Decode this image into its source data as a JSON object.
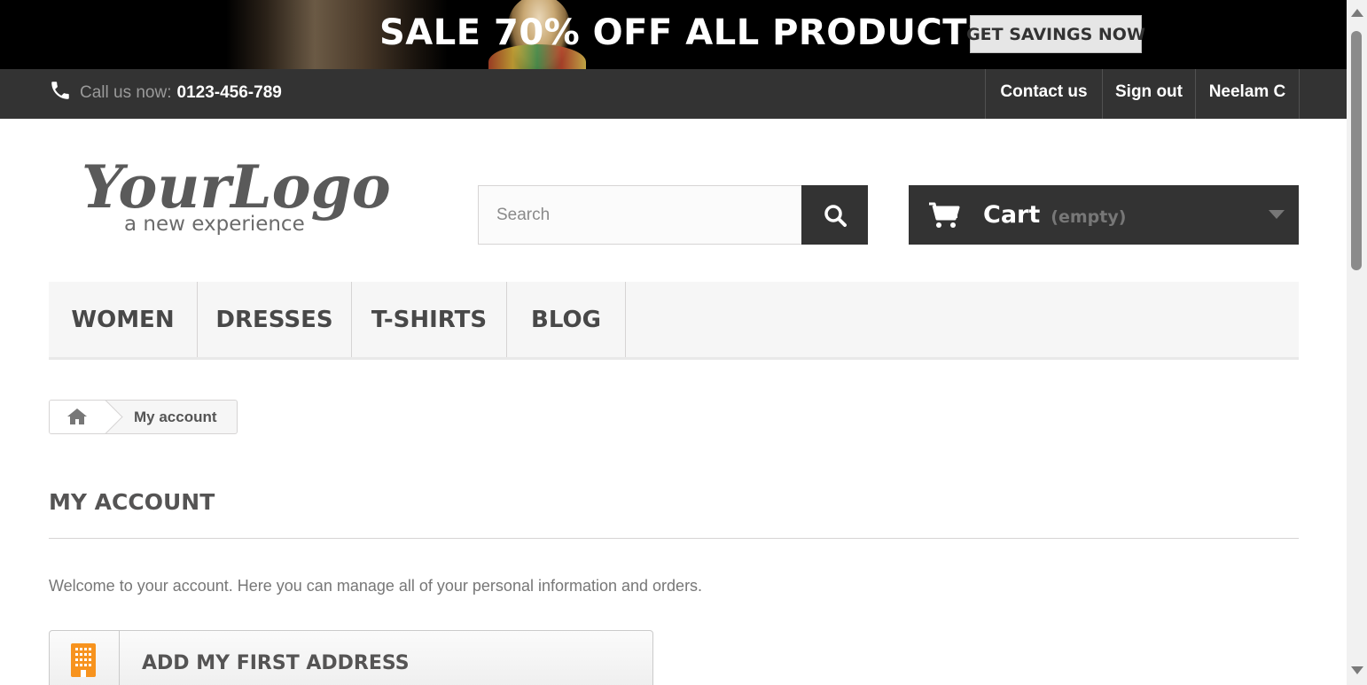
{
  "banner": {
    "headline": "SALE 70% OFF ALL PRODUCTS",
    "cta_label": "GET SAVINGS NOW"
  },
  "top_nav": {
    "call_label": "Call us now:",
    "phone_number": "0123-456-789",
    "links": [
      "Contact us",
      "Sign out",
      "Neelam C"
    ]
  },
  "header": {
    "logo": {
      "main_text": "YourLogo",
      "tagline": "a new experience"
    },
    "search": {
      "placeholder": "Search",
      "value": ""
    },
    "cart": {
      "label": "Cart",
      "status": "(empty)"
    }
  },
  "menu": {
    "items": [
      "WOMEN",
      "DRESSES",
      "T-SHIRTS",
      "BLOG"
    ]
  },
  "breadcrumb": {
    "current": "My account"
  },
  "page": {
    "heading": "MY ACCOUNT",
    "welcome": "Welcome to your account. Here you can manage all of your personal information and orders.",
    "actions": [
      {
        "label": "ADD MY FIRST ADDRESS",
        "icon": "building-icon"
      }
    ]
  },
  "colors": {
    "dark_bar": "#333333",
    "menu_bg": "#f6f6f6",
    "accent_orange": "#f7931e"
  }
}
